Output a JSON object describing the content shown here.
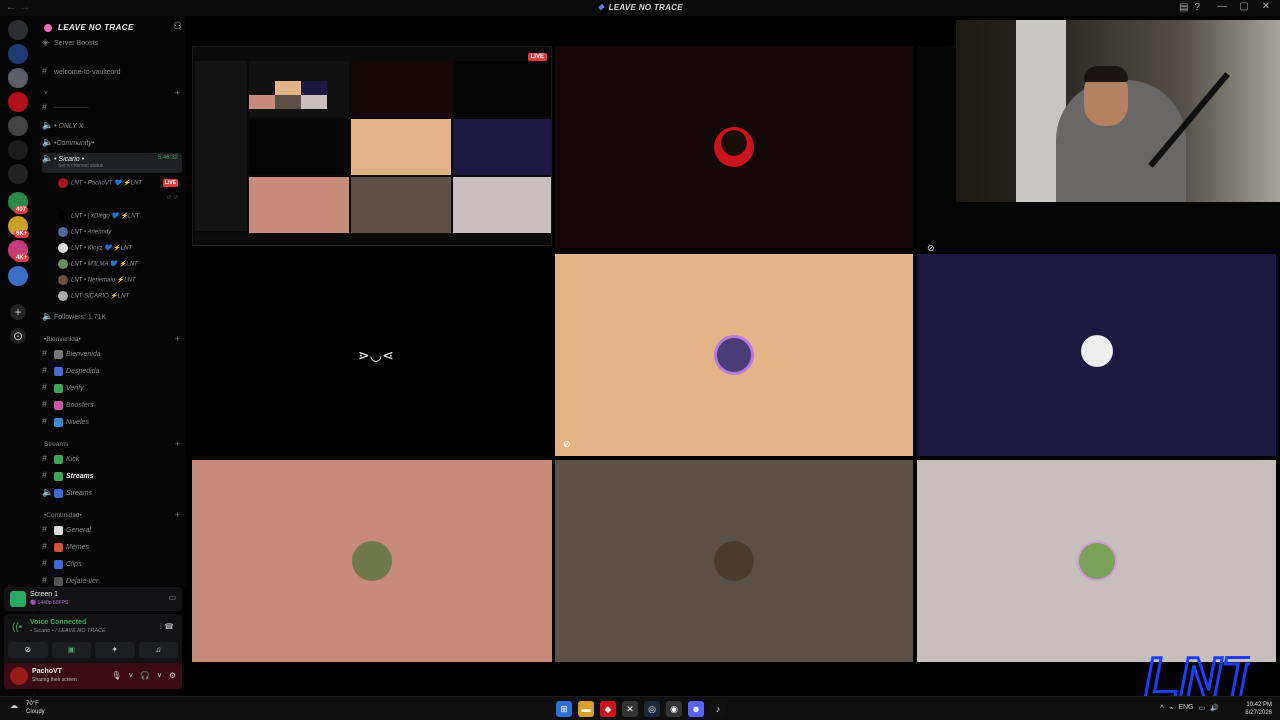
{
  "window": {
    "title": "LEAVE NO TRACE",
    "controls": [
      "—",
      "▢",
      "✕"
    ]
  },
  "server": {
    "name": "LEAVE NO TRACE",
    "top_item": "Server Boosts"
  },
  "channels": {
    "welcome": "welcome-to-vaultcord",
    "only_x": "• ONLY X",
    "community": "•Community•",
    "sicario": "• Sicario •",
    "sicario_timer": "5:46:32",
    "sicario_status": "Set a channel status",
    "followers": "Followers: 1.71K",
    "cat_bienvenida": "•Bienvenida•",
    "bienvenida": "Bienvenida",
    "despedida": "Despedida",
    "verify": "Verify",
    "boosters": "Boosters",
    "niveles": "Niveles",
    "cat_streams": "Streams",
    "kick": "Kick",
    "streams_text": "Streams",
    "streams_voice": "Streams",
    "cat_comunidad": "•Comunidad•",
    "general": "General",
    "memes": "Memes",
    "clips": "Clips",
    "dejate_ver": "Dejate-ver"
  },
  "voice_users": [
    {
      "name": "LNT • PachoVT 💙 ⚡LNT",
      "live": "LIVE"
    },
    {
      "name": "LNT • | xDiego 💙 ⚡LNT"
    },
    {
      "name": "LNT • Arlenndy"
    },
    {
      "name": "LNT • Kloyz 💙 ⚡LNT"
    },
    {
      "name": "LNT • M3LMA 💙 ⚡LNT"
    },
    {
      "name": "LNT • Nenemalo ⚡LNT"
    },
    {
      "name": "LNT SICARIO ⚡LNT"
    }
  ],
  "screen_card": {
    "title": "Screen 1",
    "subtitle": "🟣 1440p 60FPS"
  },
  "voice": {
    "status": "Voice Connected",
    "channel": "• Sicario • / LEAVE NO TRACE"
  },
  "user": {
    "name": "PachoVT",
    "status": "Sharing their screen"
  },
  "stage": {
    "live_badge": "LIVE"
  },
  "taskbar": {
    "temp": "70°F",
    "weather": "Cloudy",
    "lang": "ENG",
    "time": "10:42 PM",
    "date": "8/27/2026"
  },
  "logo_text": "LNT",
  "colors": {
    "accent_green": "#3ba55c",
    "live_red": "#e23b40",
    "tile_peach": "#e2b487",
    "tile_navy": "#1d1840",
    "tile_salmon": "#c88a7a",
    "tile_taupe": "#5b5046",
    "tile_silver": "#c6bfbd",
    "logo_blue": "#1a40ff"
  }
}
